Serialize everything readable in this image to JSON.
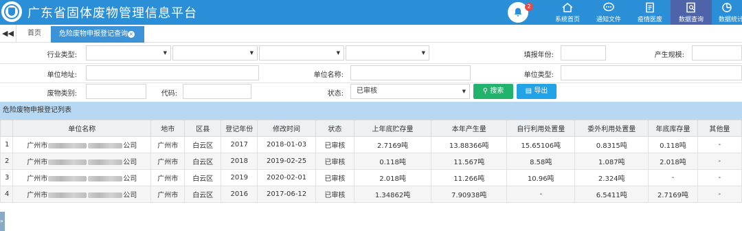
{
  "header": {
    "title": "广东省固体废物管理信息平台",
    "bell_count": "2",
    "nav": [
      {
        "label": "系统首页",
        "icon": "home-icon"
      },
      {
        "label": "通知文件",
        "icon": "chat-icon"
      },
      {
        "label": "疫情医废",
        "icon": "document-icon"
      },
      {
        "label": "数据查询",
        "icon": "search-document-icon"
      },
      {
        "label": "数据统计",
        "icon": "pie-chart-icon"
      }
    ]
  },
  "tabs": {
    "back": "◀◀",
    "home": "首页",
    "active": "危险废物申报登记查询",
    "close": "×"
  },
  "form": {
    "industry_type_label": "行业类型:",
    "fill_year_label": "填报年份:",
    "scale_label": "产生规模:",
    "unit_address_label": "单位地址:",
    "unit_name_label": "单位名称:",
    "unit_type_label": "单位类型:",
    "waste_category_label": "废物类别:",
    "code_label": "代码:",
    "status_label": "状态:",
    "status_value": "已审核",
    "search_button": "搜索",
    "export_button": "导出"
  },
  "table": {
    "title": "危险废物申报登记列表",
    "columns": [
      "",
      "单位名称",
      "地市",
      "区县",
      "登记年份",
      "修改时间",
      "状态",
      "上年底贮存量",
      "本年产生量",
      "自行利用处置量",
      "委外利用处置量",
      "年底库存量",
      "其他量"
    ],
    "rows": [
      {
        "no": "1",
        "name_prefix": "广州市",
        "name_suffix": "公司",
        "city": "广州市",
        "district": "白云区",
        "year": "2017",
        "modified": "2018-01-03",
        "status": "已审核",
        "prev_stock": "2.7169吨",
        "produced": "13.88366吨",
        "self_used": "15.65106吨",
        "outsourced": "0.8315吨",
        "year_end": "0.118吨",
        "other": "-"
      },
      {
        "no": "2",
        "name_prefix": "广州市",
        "name_suffix": "公司",
        "city": "广州市",
        "district": "白云区",
        "year": "2018",
        "modified": "2019-02-25",
        "status": "已审核",
        "prev_stock": "0.118吨",
        "produced": "11.567吨",
        "self_used": "8.58吨",
        "outsourced": "1.087吨",
        "year_end": "2.018吨",
        "other": "-"
      },
      {
        "no": "3",
        "name_prefix": "广州市",
        "name_suffix": "公司",
        "city": "广州市",
        "district": "白云区",
        "year": "2019",
        "modified": "2020-02-01",
        "status": "已审核",
        "prev_stock": "2.018吨",
        "produced": "11.266吨",
        "self_used": "10.96吨",
        "outsourced": "2.324吨",
        "year_end": "-",
        "other": "-"
      },
      {
        "no": "4",
        "name_prefix": "广州市",
        "name_suffix": "公司",
        "city": "广州市",
        "district": "白云区",
        "year": "2016",
        "modified": "2017-06-12",
        "status": "已审核",
        "prev_stock": "1.34862吨",
        "produced": "7.90938吨",
        "self_used": "-",
        "outsourced": "6.5411吨",
        "year_end": "2.7169吨",
        "other": "-"
      }
    ]
  },
  "side_handle": "»",
  "colors": {
    "header": "#2b8fd8",
    "nav_active": "#4e63a8",
    "tab_active": "#3c93d8",
    "search": "#21b36b",
    "export": "#22a3e6",
    "section": "#b7d8f2",
    "badge": "#e24b4b"
  }
}
